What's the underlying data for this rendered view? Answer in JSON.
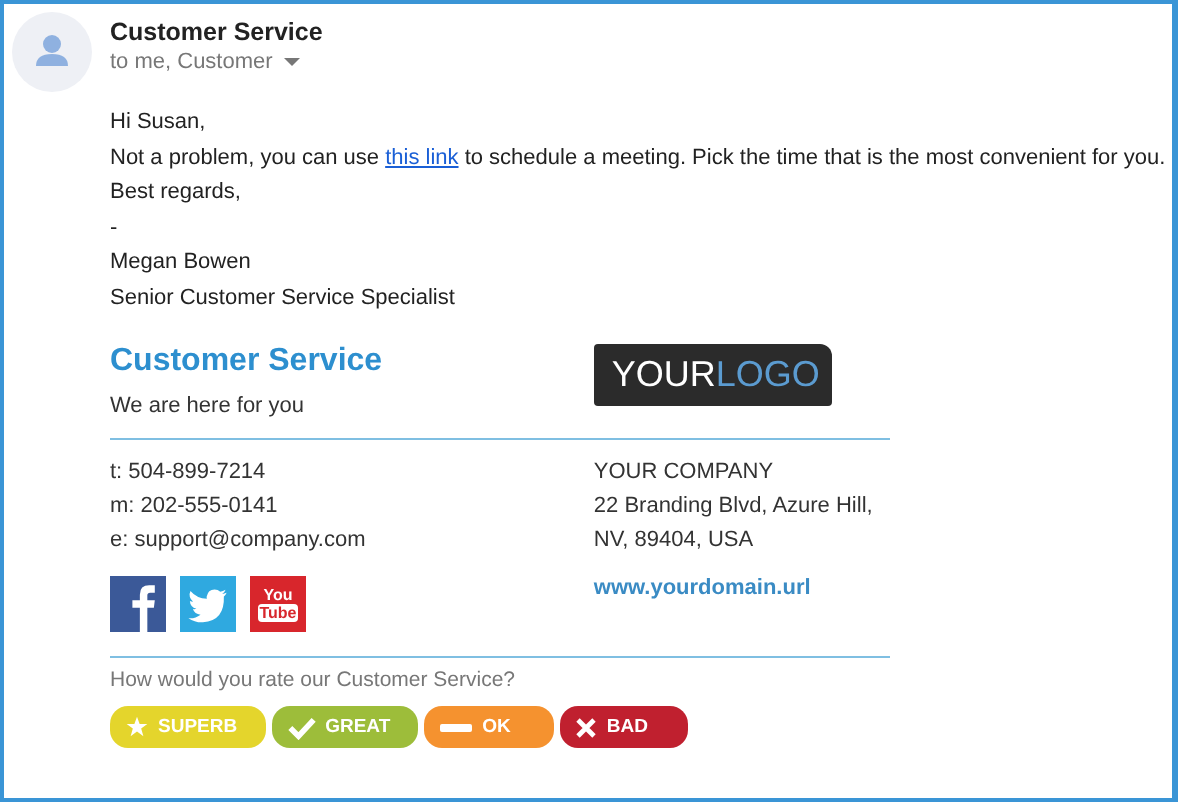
{
  "sender": {
    "name": "Customer Service",
    "recipients": "to me, Customer"
  },
  "message": {
    "greeting": "Hi Susan,",
    "before_link": "Not a problem, you can use ",
    "link": "this link",
    "after_link": " to schedule a meeting. Pick the time that is the most convenient for you.",
    "lines": [
      "Best regards,",
      "-",
      "Megan Bowen",
      "Senior Customer Service Specialist"
    ]
  },
  "signature": {
    "title": "Customer Service",
    "tagline": "We are here for you",
    "logo": {
      "first": "YOUR",
      "second": "LOGO"
    },
    "contacts": [
      "t: 504-899-7214",
      "m: 202-555-0141",
      "e: support@company.com"
    ],
    "address": [
      "YOUR COMPANY",
      "22 Branding Blvd, Azure Hill,",
      "NV, 89404, USA"
    ],
    "website": "www.yourdomain.url",
    "social": [
      {
        "kind": "facebook",
        "color": "#3b5998"
      },
      {
        "kind": "twitter",
        "color": "#2fa9e0"
      },
      {
        "kind": "youtube",
        "color": "#d8262c",
        "text": [
          "You",
          "Tube"
        ]
      }
    ],
    "rating_prompt": "How would you rate our Customer Service?",
    "ratings": [
      {
        "kind": "star",
        "label": "SUPERB",
        "color": "#e4d52c"
      },
      {
        "kind": "check",
        "label": "GREAT",
        "color": "#9dbd3a"
      },
      {
        "kind": "dash",
        "label": "OK",
        "color": "#f5922f"
      },
      {
        "kind": "cross",
        "label": "BAD",
        "color": "#c0202f"
      }
    ]
  }
}
